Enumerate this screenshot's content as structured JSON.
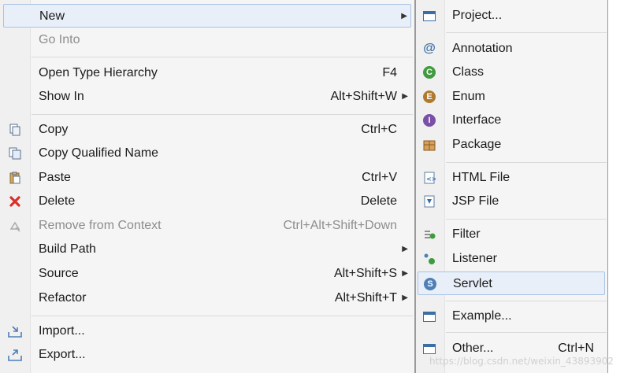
{
  "main_menu": {
    "items": [
      {
        "label": "New",
        "shortcut": "",
        "submenu": true,
        "icon": "",
        "disabled": false,
        "highlight": true
      },
      {
        "label": "Go Into",
        "shortcut": "",
        "submenu": false,
        "icon": "",
        "disabled": true
      },
      {
        "label": "Open Type Hierarchy",
        "shortcut": "F4",
        "submenu": false,
        "icon": ""
      },
      {
        "label": "Show In",
        "shortcut": "Alt+Shift+W",
        "submenu": true,
        "icon": ""
      },
      {
        "label": "Copy",
        "shortcut": "Ctrl+C",
        "submenu": false,
        "icon": "copy-icon"
      },
      {
        "label": "Copy Qualified Name",
        "shortcut": "",
        "submenu": false,
        "icon": "copy-qualified-name-icon"
      },
      {
        "label": "Paste",
        "shortcut": "Ctrl+V",
        "submenu": false,
        "icon": "paste-icon"
      },
      {
        "label": "Delete",
        "shortcut": "Delete",
        "submenu": false,
        "icon": "delete-icon"
      },
      {
        "label": "Remove from Context",
        "shortcut": "Ctrl+Alt+Shift+Down",
        "submenu": false,
        "icon": "remove-context-icon",
        "disabled": true
      },
      {
        "label": "Build Path",
        "shortcut": "",
        "submenu": true,
        "icon": ""
      },
      {
        "label": "Source",
        "shortcut": "Alt+Shift+S",
        "submenu": true,
        "icon": ""
      },
      {
        "label": "Refactor",
        "shortcut": "Alt+Shift+T",
        "submenu": true,
        "icon": ""
      },
      {
        "label": "Import...",
        "shortcut": "",
        "submenu": false,
        "icon": "import-icon"
      },
      {
        "label": "Export...",
        "shortcut": "",
        "submenu": false,
        "icon": "export-icon"
      }
    ]
  },
  "sub_menu": {
    "items": [
      {
        "label": "Project...",
        "shortcut": "",
        "icon": "project-icon"
      },
      {
        "label": "Annotation",
        "shortcut": "",
        "icon": "annotation-icon"
      },
      {
        "label": "Class",
        "shortcut": "",
        "icon": "class-icon"
      },
      {
        "label": "Enum",
        "shortcut": "",
        "icon": "enum-icon"
      },
      {
        "label": "Interface",
        "shortcut": "",
        "icon": "interface-icon"
      },
      {
        "label": "Package",
        "shortcut": "",
        "icon": "package-icon"
      },
      {
        "label": "HTML File",
        "shortcut": "",
        "icon": "html-file-icon"
      },
      {
        "label": "JSP File",
        "shortcut": "",
        "icon": "jsp-file-icon"
      },
      {
        "label": "Filter",
        "shortcut": "",
        "icon": "filter-icon"
      },
      {
        "label": "Listener",
        "shortcut": "",
        "icon": "listener-icon"
      },
      {
        "label": "Servlet",
        "shortcut": "",
        "icon": "servlet-icon",
        "highlight": true
      },
      {
        "label": "Example...",
        "shortcut": "",
        "icon": "example-icon"
      },
      {
        "label": "Other...",
        "shortcut": "Ctrl+N",
        "icon": "other-icon"
      }
    ]
  },
  "icon_glyphs": {
    "annotation": "@",
    "class": "C",
    "enum": "E",
    "interface": "I",
    "servlet": "S",
    "arrow": "▶"
  },
  "watermark": "https://blog.csdn.net/weixin_43893902",
  "colors": {
    "highlight_bg": "#e8eff9",
    "highlight_border": "#a9c3e6",
    "menu_bg": "#f5f5f5"
  }
}
